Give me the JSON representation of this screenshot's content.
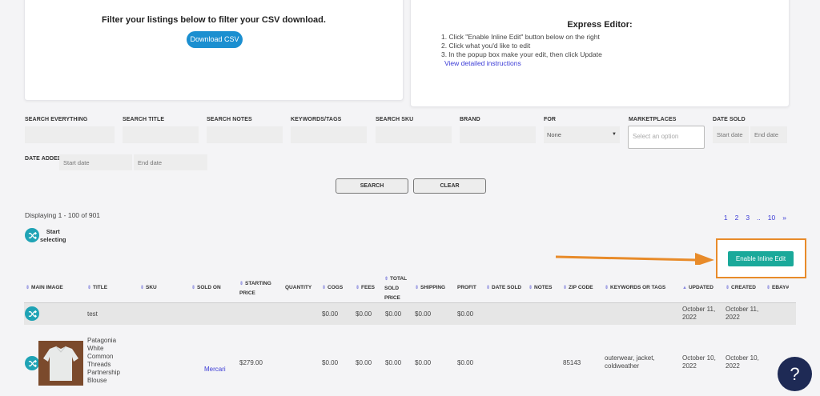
{
  "csv_card": {
    "heading": "Filter your listings below to filter your CSV download.",
    "button": "Download CSV"
  },
  "express": {
    "heading": "Express Editor:",
    "steps": [
      "1. Click \"Enable Inline Edit\" button below on the right",
      "2. Click what you'd like to edit",
      "3. In the popup box make your edit, then click Update"
    ],
    "link": "View detailed instructions"
  },
  "filters": {
    "search_everything": "SEARCH EVERYTHING",
    "search_title": "SEARCH TITLE",
    "search_notes": "SEARCH NOTES",
    "keywords": "KEYWORDS/TAGS",
    "search_sku": "SEARCH SKU",
    "brand": "BRAND",
    "for_label": "FOR",
    "for_value": "None",
    "marketplaces": "MARKETPLACES",
    "marketplaces_placeholder": "Select an option",
    "date_sold": "DATE SOLD",
    "date_added": "DATE ADDED",
    "start_date": "Start date",
    "end_date": "End date"
  },
  "buttons": {
    "search": "SEARCH",
    "clear": "CLEAR",
    "enable_inline": "Enable Inline Edit"
  },
  "displaying": "Displaying 1 - 100 of 901",
  "pager": [
    "1",
    "2",
    "3",
    "..",
    "10",
    "»"
  ],
  "start_selecting": [
    "Start",
    "selecting"
  ],
  "columns": {
    "main_image": "MAIN IMAGE",
    "title": "TITLE",
    "sku": "SKU",
    "sold_on": "SOLD ON",
    "starting": "STARTING",
    "price": "PRICE",
    "quantity": "QUANTITY",
    "cogs": "COGS",
    "fees": "FEES",
    "total": "TOTAL",
    "sold": "SOLD",
    "price2": "PRICE",
    "shipping": "SHIPPING",
    "profit": "PROFIT",
    "date_sold": "DATE SOLD",
    "notes": "NOTES",
    "zip": "ZIP CODE",
    "keywords": "KEYWORDS OR TAGS",
    "updated": "UPDATED",
    "created": "CREATED",
    "ebay": "EBAY#"
  },
  "rows": [
    {
      "title": "test",
      "cogs": "$0.00",
      "fees": "$0.00",
      "total": "$0.00",
      "shipping": "$0.00",
      "profit": "$0.00",
      "updated": [
        "October 11,",
        "2022"
      ],
      "created": [
        "October 11,",
        "2022"
      ]
    },
    {
      "title": [
        "Patagonia",
        "White",
        "Common",
        "Threads",
        "Partnership",
        "Blouse"
      ],
      "sold_on": "Mercari",
      "price": "$279.00",
      "cogs": "$0.00",
      "fees": "$0.00",
      "total": "$0.00",
      "shipping": "$0.00",
      "profit": "$0.00",
      "zip": "85143",
      "keywords": [
        "outerwear, jacket,",
        "coldweather"
      ],
      "updated": [
        "October 10,",
        "2022"
      ],
      "created": [
        "October 10,",
        "2022"
      ]
    }
  ],
  "help": "?",
  "colors": {
    "primary_blue": "#1b8fd0",
    "teal": "#1aa99a",
    "annotation_orange": "#e88b2a",
    "help_navy": "#1e2a55"
  }
}
